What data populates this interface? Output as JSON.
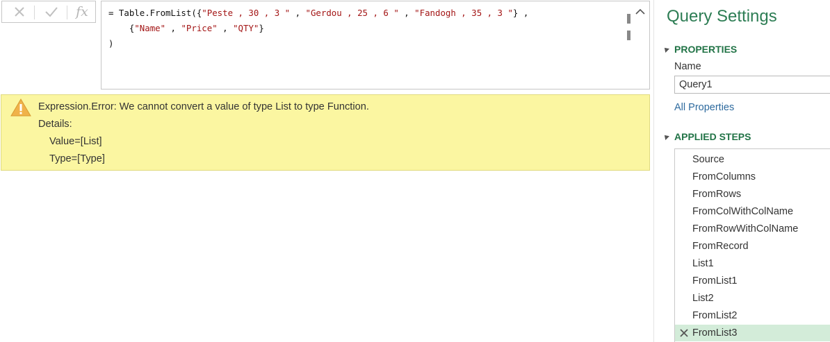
{
  "formula_bar": {
    "icons": {
      "cancel": "x-icon",
      "commit": "check-icon",
      "fx": "fx-icon"
    },
    "fx_label": "fx",
    "line1": {
      "prefix": "= Table.FromList({",
      "s1": "\"Peste , 30 , 3 \"",
      "sep1": " , ",
      "s2": "\"Gerdou , 25 , 6 \"",
      "sep2": " , ",
      "s3": "\"Fandogh , 35 , 3 \"",
      "suffix": "} ,"
    },
    "line2": {
      "prefix": "    {",
      "s1": "\"Name\"",
      "sep1": " , ",
      "s2": "\"Price\"",
      "sep2": " , ",
      "s3": "\"QTY\"",
      "suffix": "}"
    },
    "line3": ")"
  },
  "error": {
    "icon": "warning-icon",
    "message": "Expression.Error: We cannot convert a value of type List to type Function.",
    "details_label": "Details:",
    "value": "Value=[List]",
    "type": "Type=[Type]",
    "colors": {
      "background": "#fbf6a1",
      "border": "#e0da7e"
    }
  },
  "query_settings": {
    "title": "Query Settings",
    "properties": {
      "header": "PROPERTIES",
      "name_label": "Name",
      "name_value": "Query1",
      "all_properties": "All Properties"
    },
    "applied_steps": {
      "header": "APPLIED STEPS",
      "steps": [
        "Source",
        "FromColumns",
        "FromRows",
        "FromColWithColName",
        "FromRowWithColName",
        "FromRecord",
        "List1",
        "FromList1",
        "List2",
        "FromList2",
        "FromList3"
      ],
      "selected": "FromList3"
    },
    "colors": {
      "title": "#2d7d54",
      "header": "#217346",
      "selected_row": "#d3ecd9",
      "link": "#2d6a9e"
    }
  }
}
